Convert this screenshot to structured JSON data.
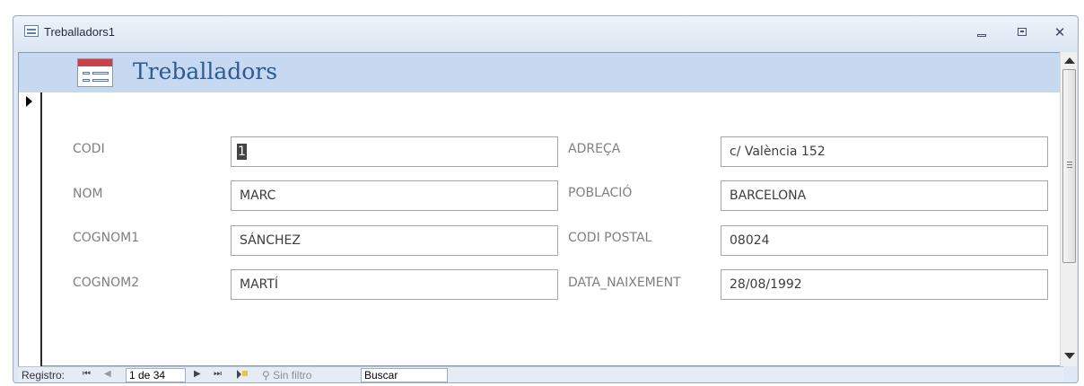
{
  "window": {
    "title": "Treballadors1"
  },
  "form": {
    "title": "Treballadors"
  },
  "fields_left": [
    {
      "label": "CODI",
      "value": "1"
    },
    {
      "label": "NOM",
      "value": "MARC"
    },
    {
      "label": "COGNOM1",
      "value": "SÁNCHEZ"
    },
    {
      "label": "COGNOM2",
      "value": "MARTÍ"
    }
  ],
  "fields_right": [
    {
      "label": "ADREÇA",
      "value": "c/ València 152"
    },
    {
      "label": "POBLACIÓ",
      "value": "BARCELONA"
    },
    {
      "label": "CODI POSTAL",
      "value": "08024"
    },
    {
      "label": "DATA_NAIXEMENT",
      "value": "28/08/1992"
    }
  ],
  "navigation": {
    "label": "Registro:",
    "first_icon": "first-record-icon",
    "prev_icon": "previous-record-icon",
    "record": "1 de 34",
    "next_icon": "next-record-icon",
    "last_icon": "last-record-icon",
    "new_icon": "new-record-icon",
    "filter": "Sin filtro",
    "search": "Buscar"
  },
  "colors": {
    "header_band": "#c6d9f1",
    "title_text": "#2b5b93",
    "label_text": "#7f7f7f"
  }
}
